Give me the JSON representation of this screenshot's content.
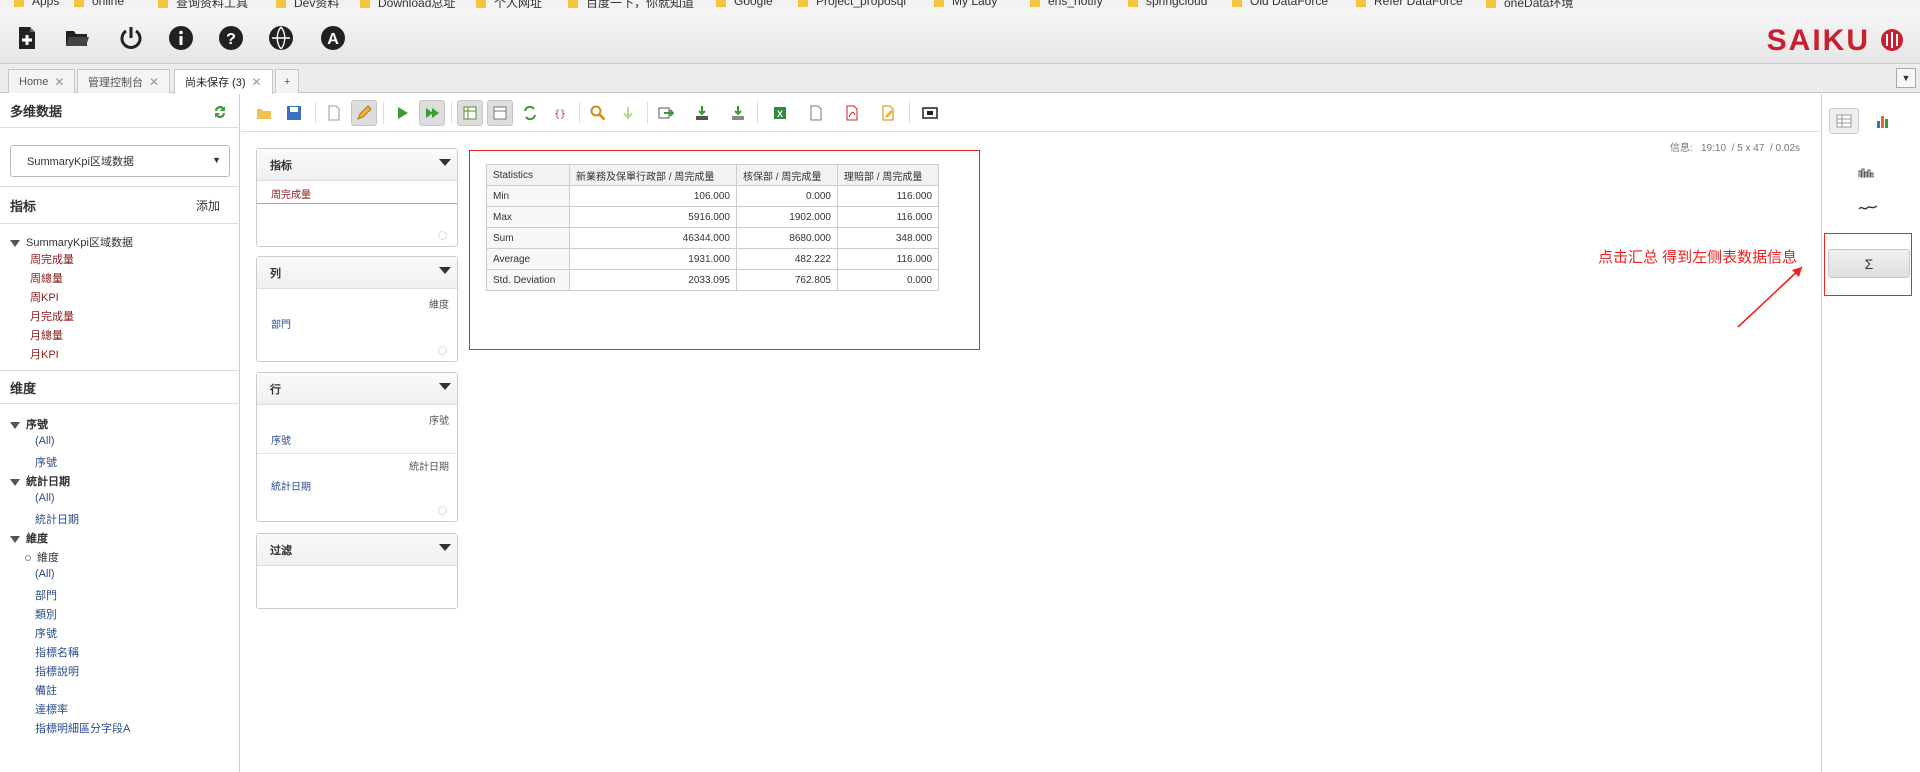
{
  "bookmarks": [
    "Apps",
    "online",
    "查询资料工具",
    "Dev资料",
    "Download总址",
    "个人网址",
    "百度一下，你就知道",
    "Google",
    "Project_proposql",
    "My Lady",
    "ens_notify",
    "springcloud",
    "Old DataForce",
    "Refer DataForce",
    "oneData环境"
  ],
  "topbar": {
    "icons": [
      "new-query-icon",
      "open-folder-icon",
      "power-icon",
      "info-icon",
      "help-icon",
      "language-icon",
      "admin-icon"
    ],
    "logo": "SAIKU"
  },
  "tabs": [
    {
      "label": "Home",
      "active": false
    },
    {
      "label": "管理控制台",
      "active": false
    },
    {
      "label": "尚未保存 (3)",
      "active": true
    }
  ],
  "tab_add": "+",
  "left_panel": {
    "title": "多维数据",
    "cube_selected": "SummaryKpi区域数据",
    "measures_title": "指标",
    "add_label": "添加",
    "measures_root": "SummaryKpi区域数据",
    "measures": [
      "周完成量",
      "周總量",
      "周KPI",
      "月完成量",
      "月總量",
      "月KPI"
    ],
    "dimensions_title": "维度",
    "dimensions": [
      {
        "name": "序號",
        "levels": [
          "(All)",
          "序號"
        ]
      },
      {
        "name": "統計日期",
        "levels": [
          "(All)",
          "統計日期"
        ]
      },
      {
        "name": "維度",
        "hierarchy": "維度",
        "levels": [
          "(All)",
          "部門",
          "類別",
          "序號",
          "指標名稱",
          "指標說明",
          "備註",
          "達標率",
          "指標明細區分字段A"
        ]
      }
    ]
  },
  "info": {
    "label": "信息:",
    "time": "19:10",
    "size": "5 x 47",
    "duration": "0.02s"
  },
  "zones": {
    "measures": {
      "title": "指标",
      "item": "周完成量"
    },
    "columns": {
      "title": "列",
      "hierarchy": "維度",
      "level": "部門"
    },
    "rows": {
      "title": "行",
      "hierarchy1": "序號",
      "level1": "序號",
      "hierarchy2": "統計日期",
      "level2": "統計日期"
    },
    "filter": {
      "title": "过滤"
    }
  },
  "stats_table": {
    "headers": [
      "Statistics",
      "新業務及保單行政部 / 周完成量",
      "核保部 / 周完成量",
      "理賠部 / 周完成量"
    ],
    "rows": [
      {
        "label": "Min",
        "values": [
          "106.000",
          "0.000",
          "116.000"
        ]
      },
      {
        "label": "Max",
        "values": [
          "5916.000",
          "1902.000",
          "116.000"
        ]
      },
      {
        "label": "Sum",
        "values": [
          "46344.000",
          "8680.000",
          "348.000"
        ]
      },
      {
        "label": "Average",
        "values": [
          "1931.000",
          "482.222",
          "116.000"
        ]
      },
      {
        "label": "Std. Deviation",
        "values": [
          "2033.095",
          "762.805",
          "0.000"
        ]
      }
    ]
  },
  "right_sidebar": {
    "sigma": "Σ"
  },
  "annotation": "点击汇总 得到左侧表数据信息",
  "colors": {
    "accent_red": "#e22222",
    "logo_red": "#c8202f",
    "measure": "#8b1a1a",
    "level": "#2a4d8f"
  }
}
